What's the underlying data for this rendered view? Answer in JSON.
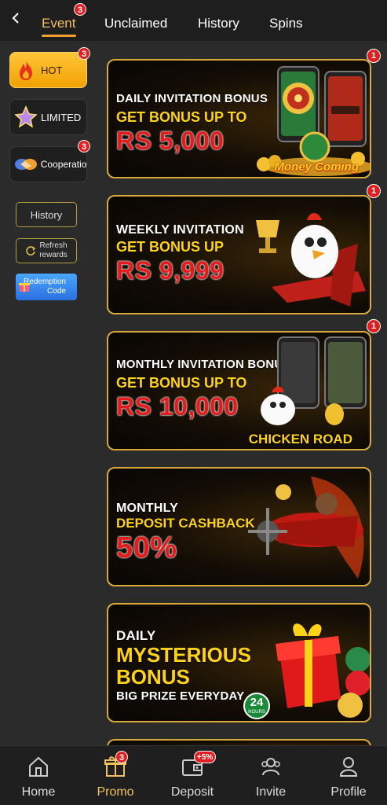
{
  "top_tabs": [
    {
      "label": "Event",
      "badge": "3",
      "active": true
    },
    {
      "label": "Unclaimed"
    },
    {
      "label": "History"
    },
    {
      "label": "Spins"
    }
  ],
  "sidebar": {
    "categories": [
      {
        "label": "HOT",
        "badge": "3",
        "icon": "fire-icon",
        "active": true
      },
      {
        "label": "LIMITED",
        "icon": "star-icon"
      },
      {
        "label": "Cooperatio",
        "badge": "3",
        "icon": "handshake-icon"
      }
    ],
    "history_label": "History",
    "refresh_label_1": "Refresh",
    "refresh_label_2": "rewards",
    "redeem_label_1": "Redemption",
    "redeem_label_2": "Code"
  },
  "banners": [
    {
      "line1": "DAILY INVITATION BONUS",
      "line2": "GET BONUS UP TO",
      "line3": "RS 5,000",
      "badge": "1",
      "logo": "Money Coming"
    },
    {
      "line1": "WEEKLY INVITATION",
      "line2": "GET BONUS UP",
      "line3": "RS 9,999",
      "badge": "1"
    },
    {
      "line1": "MONTHLY INVITATION BONUS",
      "line2": "GET BONUS UP TO",
      "line3": "RS 10,000",
      "badge": "1",
      "logo": "CHICKEN ROAD"
    },
    {
      "line1": "MONTHLY",
      "line2": "DEPOSIT CASHBACK",
      "line3": "50%"
    },
    {
      "line1": "DAILY",
      "line2": "MYSTERIOUS",
      "line2b": "BONUS",
      "line3": "BIG PRIZE EVERYDAY",
      "hours": "24",
      "hours_label": "HOURS"
    }
  ],
  "bottom_nav": [
    {
      "label": "Home",
      "icon": "home-icon"
    },
    {
      "label": "Promo",
      "icon": "gift-icon",
      "badge": "3",
      "active": true
    },
    {
      "label": "Deposit",
      "icon": "wallet-icon",
      "badge": "+5%"
    },
    {
      "label": "Invite",
      "icon": "users-icon"
    },
    {
      "label": "Profile",
      "icon": "user-icon"
    }
  ],
  "colors": {
    "accent": "#f0c060",
    "badge": "#e02020",
    "banner_border": "#d9a93a"
  }
}
